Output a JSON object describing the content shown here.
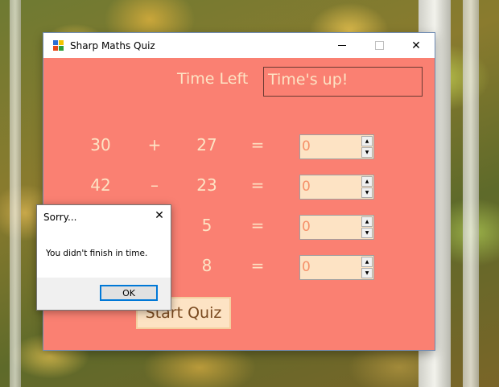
{
  "window": {
    "title": "Sharp Maths Quiz",
    "icon": "app-icon",
    "controls": {
      "minimize": "minimize-icon",
      "maximize": "maximize-icon",
      "close": "✕"
    }
  },
  "timer": {
    "label": "Time Left",
    "value": "Time's up!"
  },
  "problems": [
    {
      "left": "30",
      "op": "+",
      "right": "27",
      "eq": "=",
      "answer": "0"
    },
    {
      "left": "42",
      "op": "–",
      "right": "23",
      "eq": "=",
      "answer": "0"
    },
    {
      "left": "",
      "op": "",
      "right": "5",
      "eq": "=",
      "answer": "0"
    },
    {
      "left": "",
      "op": "",
      "right": "8",
      "eq": "=",
      "answer": "0"
    }
  ],
  "start_button": {
    "label": "Start Quiz"
  },
  "dialog": {
    "title": "Sorry...",
    "close": "✕",
    "message": "You didn't finish in time.",
    "ok_label": "OK"
  },
  "colors": {
    "form_bg": "#fa8072",
    "label_text": "#fde3c4",
    "accent": "#0078d7"
  }
}
